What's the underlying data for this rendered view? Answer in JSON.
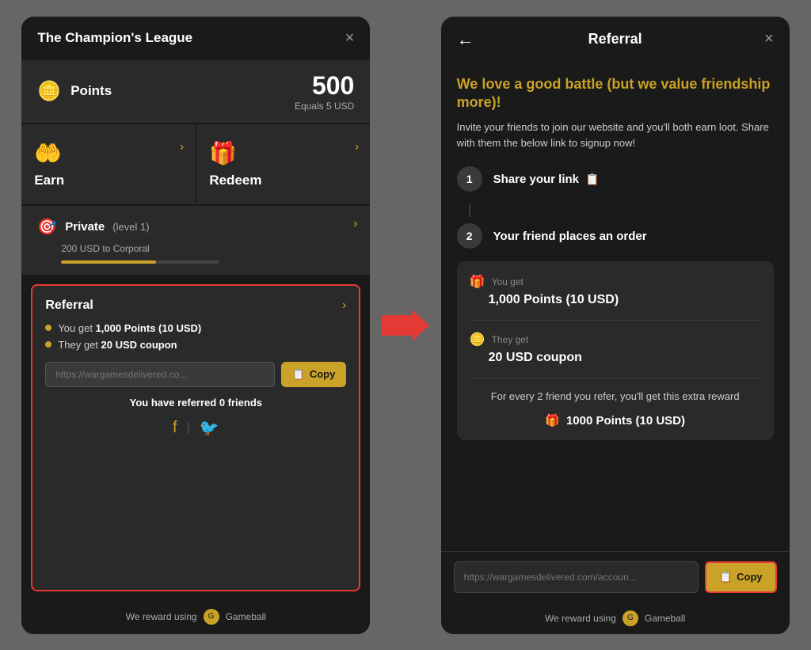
{
  "left": {
    "header": {
      "title": "The Champion's League",
      "close_label": "×"
    },
    "points": {
      "icon": "🪙",
      "label": "Points",
      "value": "500",
      "sub": "Equals 5 USD"
    },
    "earn": {
      "icon": "🤲",
      "label": "Earn",
      "arrow": "›"
    },
    "redeem": {
      "icon": "🎁",
      "label": "Redeem",
      "arrow": "›"
    },
    "rank": {
      "icon": "🎯",
      "name": "Private",
      "level": "(level 1)",
      "sub": "200 USD to Corporal",
      "arrow": "›"
    },
    "referral": {
      "title": "Referral",
      "arrow": "›",
      "bullet1": "You get ",
      "bullet1_bold": "1,000 Points (10 USD)",
      "bullet2": "They get ",
      "bullet2_bold": "20 USD coupon",
      "link_placeholder": "https://wargamesdelivered.co...",
      "copy_label": "Copy",
      "copy_icon": "📋",
      "referred_text": "You have referred 0 friends"
    },
    "footer": {
      "text": "We reward using",
      "badge": "G"
    }
  },
  "right": {
    "header": {
      "back_label": "←",
      "title": "Referral",
      "close_label": "×"
    },
    "headline": "We love a good battle (but we value friendship more)!",
    "description": "Invite your friends to join our website and you'll both earn loot. Share with them the below link to signup now!",
    "steps": [
      {
        "num": "1",
        "label": "Share your link",
        "icon": "📋"
      },
      {
        "num": "2",
        "label": "Your friend places an order"
      }
    ],
    "reward_box": {
      "you_get_label": "You get",
      "you_get_icon": "🎁",
      "you_get_value": "1,000 Points (10 USD)",
      "they_get_label": "They get",
      "they_get_icon": "🪙",
      "they_get_value": "20 USD coupon",
      "extra_text": "For every 2 friend you refer, you'll get this extra reward",
      "extra_icon": "🎁",
      "extra_value": "1000 Points (10 USD)"
    },
    "link_placeholder": "https://wargamesdelivered.com/accoun...",
    "copy_label": "Copy",
    "copy_icon": "📋",
    "footer": {
      "text": "We reward using",
      "badge": "G"
    }
  }
}
